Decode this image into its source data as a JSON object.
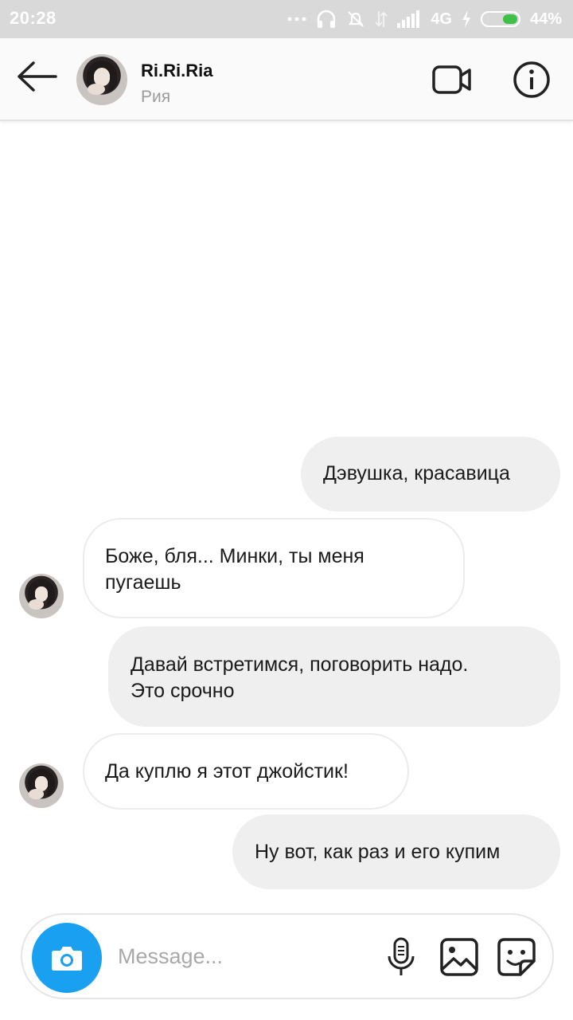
{
  "status_bar": {
    "time": "20:28",
    "network": "4G",
    "battery": "44%",
    "battery_level": 0.44
  },
  "header": {
    "username": "Ri.Ri.Ria",
    "subname": "Рия",
    "icons": {
      "back": "back-arrow-icon",
      "video": "video-call-icon",
      "info": "info-icon"
    }
  },
  "messages": [
    {
      "direction": "outgoing",
      "text": "Дэвушка, красавица"
    },
    {
      "direction": "incoming",
      "text_lines": [
        "Боже, бля... Минки, ты меня",
        "пугаешь"
      ]
    },
    {
      "direction": "outgoing",
      "text_lines": [
        "Давай встретимся, поговорить надо.",
        "Это срочно"
      ]
    },
    {
      "direction": "incoming",
      "text": "Да куплю я этот джойстик!"
    },
    {
      "direction": "outgoing",
      "text": "Ну вот, как раз и его купим"
    }
  ],
  "composer": {
    "placeholder": "Message...",
    "icons": [
      "camera-icon",
      "microphone-icon",
      "gallery-icon",
      "sticker-icon"
    ]
  },
  "colors": {
    "accent": "#1aa0f0",
    "outgoing_bubble": "#efefef",
    "battery_fill": "#3ec04a"
  }
}
